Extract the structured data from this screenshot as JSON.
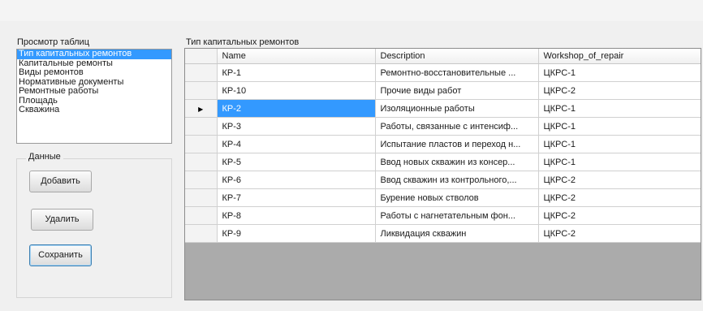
{
  "left_panel": {
    "title": "Просмотр таблиц",
    "tables": [
      "Тип капитальных ремонтов",
      "Капитальные ремонты",
      "Виды ремонтов",
      "Нормативные документы",
      "Ремонтные работы",
      "Площадь",
      "Скважина"
    ],
    "selected_index": 0
  },
  "data_group": {
    "title": "Данные",
    "add_label": "Добавить",
    "delete_label": "Удалить",
    "save_label": "Сохранить"
  },
  "grid": {
    "title": "Тип капитальных ремонтов",
    "columns": [
      "Name",
      "Description",
      "Workshop_of_repair"
    ],
    "current_row_indicator": "▶",
    "current_row_index": 2,
    "rows": [
      [
        "КР-1",
        "Ремонтно-восстановительные ...",
        "ЦКРС-1"
      ],
      [
        "КР-10",
        "Прочие виды работ",
        "ЦКРС-2"
      ],
      [
        "КР-2",
        "Изоляционные работы",
        "ЦКРС-1"
      ],
      [
        "КР-3",
        "Работы, связанные с интенсиф...",
        "ЦКРС-1"
      ],
      [
        "КР-4",
        "Испытание пластов и переход н...",
        "ЦКРС-1"
      ],
      [
        "КР-5",
        "Ввод новых скважин из консер...",
        "ЦКРС-1"
      ],
      [
        "КР-6",
        "Ввод скважин из контрольного,...",
        "ЦКРС-2"
      ],
      [
        "КР-7",
        "Бурение новых стволов",
        "ЦКРС-2"
      ],
      [
        "КР-8",
        "Работы с нагнетательным фон...",
        "ЦКРС-2"
      ],
      [
        "КР-9",
        "Ликвидация скважин",
        "ЦКРС-2"
      ]
    ]
  }
}
